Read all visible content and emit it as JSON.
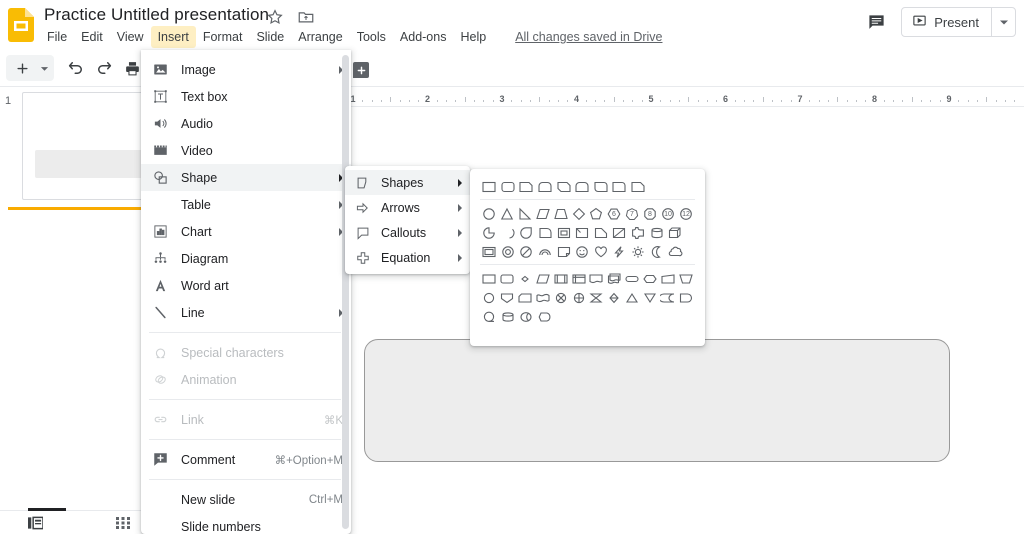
{
  "app": {
    "logo_name": "google-slides-logo",
    "title": "Practice Untitled presentation",
    "save_status": "All changes saved in Drive"
  },
  "header": {
    "star_icon": "star-icon",
    "move_icon": "move-to-folder-icon",
    "comment_icon": "comment-history-icon",
    "present_label": "Present",
    "present_icon": "present-play-icon",
    "present_caret": "chevron-down-icon"
  },
  "menubar": {
    "items": [
      {
        "label": "File",
        "active": false
      },
      {
        "label": "Edit",
        "active": false
      },
      {
        "label": "View",
        "active": false
      },
      {
        "label": "Insert",
        "active": true
      },
      {
        "label": "Format",
        "active": false
      },
      {
        "label": "Slide",
        "active": false
      },
      {
        "label": "Arrange",
        "active": false
      },
      {
        "label": "Tools",
        "active": false
      },
      {
        "label": "Add-ons",
        "active": false
      },
      {
        "label": "Help",
        "active": false
      }
    ]
  },
  "toolbar": {
    "buttons": [
      {
        "name": "new-slide-button",
        "icon": "plus-icon"
      },
      {
        "name": "new-slide-dropdown",
        "icon": "chevron-down-icon"
      },
      {
        "name": "undo-button",
        "icon": "undo-icon"
      },
      {
        "name": "redo-button",
        "icon": "redo-icon"
      },
      {
        "name": "print-button",
        "icon": "print-icon"
      },
      {
        "name": "paint-format-button",
        "icon": "paint-format-icon"
      }
    ]
  },
  "slide_panel": {
    "slide_number": "1",
    "selected": true,
    "accent_color": "#f9ab00"
  },
  "canvas": {
    "ruler_labels": [
      "1",
      "2",
      "3",
      "4",
      "5",
      "6",
      "7",
      "8",
      "9"
    ],
    "shape": {
      "name": "rounded-rectangle-shape",
      "fill": "#ededed",
      "stroke": "#999999"
    },
    "add_comment_icon": "add-comment-icon"
  },
  "bottom_bar": {
    "filmstrip_icon": "filmstrip-view-icon",
    "grid_icon": "grid-view-icon"
  },
  "insert_menu": {
    "items": [
      {
        "label": "Image",
        "icon": "image-icon",
        "accel": "",
        "submenu": true,
        "disabled": false,
        "highlighted": false
      },
      {
        "label": "Text box",
        "icon": "text-box-icon",
        "accel": "",
        "submenu": false,
        "disabled": false,
        "highlighted": false
      },
      {
        "label": "Audio",
        "icon": "audio-icon",
        "accel": "",
        "submenu": false,
        "disabled": false,
        "highlighted": false
      },
      {
        "label": "Video",
        "icon": "video-icon",
        "accel": "",
        "submenu": false,
        "disabled": false,
        "highlighted": false
      },
      {
        "label": "Shape",
        "icon": "shape-icon",
        "accel": "",
        "submenu": true,
        "disabled": false,
        "highlighted": true
      },
      {
        "label": "Table",
        "icon": "",
        "accel": "",
        "submenu": true,
        "disabled": false,
        "highlighted": false
      },
      {
        "label": "Chart",
        "icon": "chart-icon",
        "accel": "",
        "submenu": true,
        "disabled": false,
        "highlighted": false
      },
      {
        "label": "Diagram",
        "icon": "diagram-icon",
        "accel": "",
        "submenu": false,
        "disabled": false,
        "highlighted": false
      },
      {
        "label": "Word art",
        "icon": "word-art-icon",
        "accel": "",
        "submenu": false,
        "disabled": false,
        "highlighted": false
      },
      {
        "label": "Line",
        "icon": "line-icon",
        "accel": "",
        "submenu": true,
        "disabled": false,
        "highlighted": false
      },
      {
        "separator": true
      },
      {
        "label": "Special characters",
        "icon": "omega-icon",
        "accel": "",
        "submenu": false,
        "disabled": true,
        "highlighted": false
      },
      {
        "label": "Animation",
        "icon": "animation-icon",
        "accel": "",
        "submenu": false,
        "disabled": true,
        "highlighted": false
      },
      {
        "separator": true
      },
      {
        "label": "Link",
        "icon": "link-icon",
        "accel": "⌘K",
        "submenu": false,
        "disabled": true,
        "highlighted": false
      },
      {
        "separator": true
      },
      {
        "label": "Comment",
        "icon": "add-comment-icon",
        "accel": "⌘+Option+M",
        "submenu": false,
        "disabled": false,
        "highlighted": false
      },
      {
        "separator": true
      },
      {
        "label": "New slide",
        "icon": "",
        "accel": "Ctrl+M",
        "submenu": false,
        "disabled": false,
        "highlighted": false
      },
      {
        "label": "Slide numbers",
        "icon": "",
        "accel": "",
        "submenu": false,
        "disabled": false,
        "highlighted": false
      }
    ]
  },
  "shape_submenu": {
    "items": [
      {
        "label": "Shapes",
        "icon": "shapes-icon",
        "submenu": true,
        "highlighted": true
      },
      {
        "label": "Arrows",
        "icon": "arrows-icon",
        "submenu": true,
        "highlighted": false
      },
      {
        "label": "Callouts",
        "icon": "callouts-icon",
        "submenu": true,
        "highlighted": false
      },
      {
        "label": "Equation",
        "icon": "equation-icon",
        "submenu": true,
        "highlighted": false
      }
    ]
  },
  "shapes_palette": {
    "groups": [
      {
        "name": "recently-used",
        "rows": [
          [
            "rectangle",
            "rounded-rectangle",
            "snip-single-corner-rectangle",
            "round-single-corner-rectangle",
            "snip-diagonal-corner-rectangle",
            "round-same-side-corner-rectangle",
            "round-diagonal-corner-rectangle",
            "snip-and-round-single-corner-rectangle",
            "one-round-corner-rectangle"
          ]
        ]
      },
      {
        "name": "basic-shapes",
        "rows": [
          [
            "ellipse",
            "triangle",
            "right-triangle",
            "parallelogram",
            "trapezoid",
            "diamond",
            "pentagon",
            "hexagon",
            "heptagon",
            "octagon",
            "decagon",
            "dodecagon"
          ],
          [
            "pie",
            "chord",
            "teardrop",
            "frame",
            "half-frame",
            "corner",
            "diagonal-stripe",
            "cross",
            "plaque",
            "can",
            "cube"
          ],
          [
            "bevel",
            "donut",
            "no-symbol",
            "block-arc",
            "folded-corner",
            "smiley-face",
            "heart",
            "lightning-bolt",
            "sun",
            "moon",
            "cloud"
          ]
        ]
      },
      {
        "name": "flowchart-shapes",
        "rows": [
          [
            "flowchart-process",
            "flowchart-alternate-process",
            "flowchart-decision",
            "flowchart-data",
            "flowchart-predefined-process",
            "flowchart-internal-storage",
            "flowchart-document",
            "flowchart-multidocument",
            "flowchart-terminator",
            "flowchart-preparation",
            "flowchart-manual-input",
            "flowchart-manual-operation"
          ],
          [
            "flowchart-connector",
            "flowchart-off-page-connector",
            "flowchart-card",
            "flowchart-punched-tape",
            "flowchart-summing-junction",
            "flowchart-or",
            "flowchart-collate",
            "flowchart-sort",
            "flowchart-extract",
            "flowchart-merge",
            "flowchart-stored-data",
            "flowchart-delay"
          ],
          [
            "flowchart-sequential-access-storage",
            "flowchart-magnetic-disk",
            "flowchart-direct-access-storage",
            "flowchart-display"
          ]
        ]
      }
    ]
  }
}
